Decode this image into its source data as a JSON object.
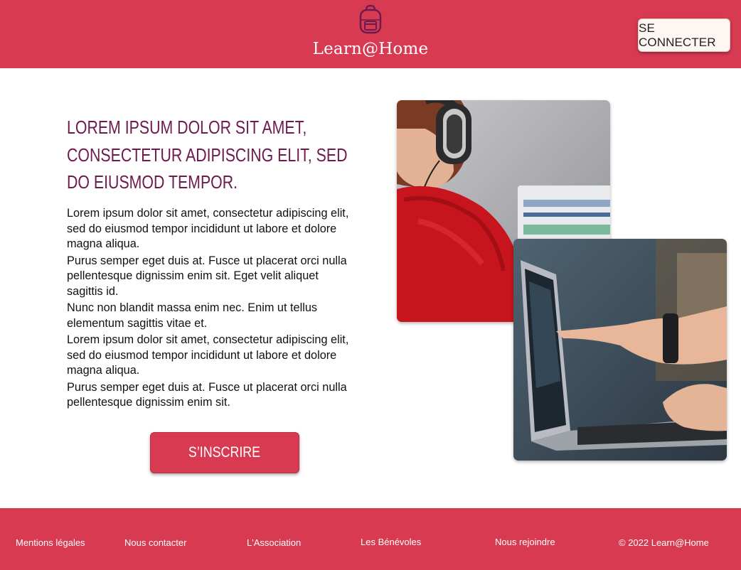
{
  "header": {
    "logo_icon": "backpack-icon",
    "brand": "Learn@Home",
    "connect_label": "SE CONNECTER",
    "background_color": "#d83a52"
  },
  "hero": {
    "title": "LOREM IPSUM DOLOR SIT AMET, CONSECTETUR ADIPISCING ELIT, SED DO EIUSMOD TEMPOR.",
    "title_color": "#6d1a4e",
    "paragraphs": [
      "Lorem ipsum dolor sit amet, consectetur adipiscing elit, sed do eiusmod tempor incididunt ut labore et dolore magna aliqua.",
      "Purus semper eget duis at. Fusce ut placerat orci nulla pellentesque dignissim enim sit. Eget velit aliquet sagittis id.",
      "Nunc non blandit massa enim nec. Enim ut tellus elementum sagittis vitae et.",
      "Lorem ipsum dolor sit amet, consectetur adipiscing elit, sed do eiusmod tempor incididunt ut labore et dolore magna aliqua.",
      "Purus semper eget duis at. Fusce ut placerat orci nulla pellentesque dignissim enim sit."
    ],
    "signup_label": "S’INSCRIRE"
  },
  "footer": {
    "links": [
      "Mentions légales",
      "Nous contacter",
      "L'Association",
      "Les Bénévoles",
      "Nous rejoindre"
    ],
    "copyright": "© 2022 Learn@Home"
  }
}
